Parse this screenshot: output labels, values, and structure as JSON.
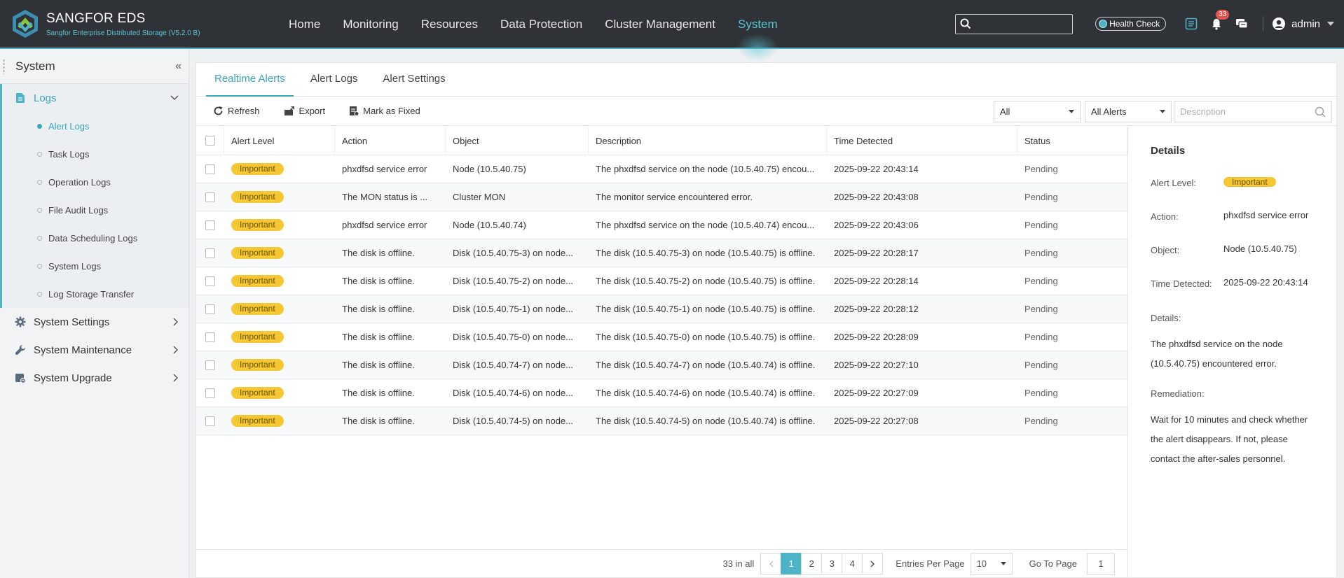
{
  "brand": {
    "name": "SANGFOR EDS",
    "subtitle": "Sangfor Enterprise Distributed Storage  (V5.2.0 B)"
  },
  "nav": [
    {
      "label": "Home"
    },
    {
      "label": "Monitoring"
    },
    {
      "label": "Resources"
    },
    {
      "label": "Data Protection"
    },
    {
      "label": "Cluster Management"
    },
    {
      "label": "System"
    }
  ],
  "topbar": {
    "health_check": "Health Check",
    "notification_count": "33",
    "user": "admin",
    "search_placeholder": ""
  },
  "sidebar": {
    "title": "System",
    "groups": [
      {
        "label": "Logs",
        "items": [
          {
            "label": "Alert Logs"
          },
          {
            "label": "Task Logs"
          },
          {
            "label": "Operation Logs"
          },
          {
            "label": "File Audit Logs"
          },
          {
            "label": "Data Scheduling Logs"
          },
          {
            "label": "System Logs"
          },
          {
            "label": "Log Storage Transfer"
          }
        ]
      },
      {
        "label": "System Settings"
      },
      {
        "label": "System Maintenance"
      },
      {
        "label": "System Upgrade"
      }
    ]
  },
  "tabs": [
    {
      "label": "Realtime Alerts"
    },
    {
      "label": "Alert Logs"
    },
    {
      "label": "Alert Settings"
    }
  ],
  "toolbar": {
    "refresh": "Refresh",
    "export": "Export",
    "mark_fixed": "Mark as Fixed",
    "filter1": "All",
    "filter2": "All Alerts",
    "description_placeholder": "Description"
  },
  "table": {
    "headers": {
      "level": "Alert Level",
      "action": "Action",
      "object": "Object",
      "description": "Description",
      "time": "Time Detected",
      "status": "Status"
    },
    "rows": [
      {
        "level": "Important",
        "action": "phxdfsd service error",
        "object": "Node (10.5.40.75)",
        "description": "The phxdfsd service on the node (10.5.40.75) encou...",
        "time": "2025-09-22 20:43:14",
        "status": "Pending"
      },
      {
        "level": "Important",
        "action": "The MON status is ...",
        "object": "Cluster MON",
        "description": "The monitor service encountered error.",
        "time": "2025-09-22 20:43:08",
        "status": "Pending"
      },
      {
        "level": "Important",
        "action": "phxdfsd service error",
        "object": "Node (10.5.40.74)",
        "description": "The phxdfsd service on the node (10.5.40.74) encou...",
        "time": "2025-09-22 20:43:06",
        "status": "Pending"
      },
      {
        "level": "Important",
        "action": "The disk is offline.",
        "object": "Disk (10.5.40.75-3) on node...",
        "description": "The disk (10.5.40.75-3) on node (10.5.40.75) is offline.",
        "time": "2025-09-22 20:28:17",
        "status": "Pending"
      },
      {
        "level": "Important",
        "action": "The disk is offline.",
        "object": "Disk (10.5.40.75-2) on node...",
        "description": "The disk (10.5.40.75-2) on node (10.5.40.75) is offline.",
        "time": "2025-09-22 20:28:14",
        "status": "Pending"
      },
      {
        "level": "Important",
        "action": "The disk is offline.",
        "object": "Disk (10.5.40.75-1) on node...",
        "description": "The disk (10.5.40.75-1) on node (10.5.40.75) is offline.",
        "time": "2025-09-22 20:28:12",
        "status": "Pending"
      },
      {
        "level": "Important",
        "action": "The disk is offline.",
        "object": "Disk (10.5.40.75-0) on node...",
        "description": "The disk (10.5.40.75-0) on node (10.5.40.75) is offline.",
        "time": "2025-09-22 20:28:09",
        "status": "Pending"
      },
      {
        "level": "Important",
        "action": "The disk is offline.",
        "object": "Disk (10.5.40.74-7) on node...",
        "description": "The disk (10.5.40.74-7) on node (10.5.40.74) is offline.",
        "time": "2025-09-22 20:27:10",
        "status": "Pending"
      },
      {
        "level": "Important",
        "action": "The disk is offline.",
        "object": "Disk (10.5.40.74-6) on node...",
        "description": "The disk (10.5.40.74-6) on node (10.5.40.74) is offline.",
        "time": "2025-09-22 20:27:09",
        "status": "Pending"
      },
      {
        "level": "Important",
        "action": "The disk is offline.",
        "object": "Disk (10.5.40.74-5) on node...",
        "description": "The disk (10.5.40.74-5) on node (10.5.40.74) is offline.",
        "time": "2025-09-22 20:27:08",
        "status": "Pending"
      }
    ]
  },
  "details": {
    "title": "Details",
    "level_label": "Alert Level:",
    "level_value": "Important",
    "action_label": "Action:",
    "action_value": "phxdfsd service error",
    "object_label": "Object:",
    "object_value": "Node (10.5.40.75)",
    "time_label": "Time Detected:",
    "time_value": "2025-09-22 20:43:14",
    "details_label": "Details:",
    "details_text": "The phxdfsd service on the node (10.5.40.75) encountered error.",
    "remediation_label": "Remediation:",
    "remediation_text": "Wait for 10 minutes and check whether the alert disappears. If not, please contact the after-sales personnel."
  },
  "pagination": {
    "total": "33 in all",
    "pages": [
      "1",
      "2",
      "3",
      "4"
    ],
    "current": "1",
    "entries_label": "Entries Per Page",
    "entries_value": "10",
    "goto_label": "Go To Page",
    "goto_value": "1"
  },
  "colors": {
    "accent": "#4fb3c8",
    "badge": "#f5c733",
    "topbar": "#2f3236"
  }
}
